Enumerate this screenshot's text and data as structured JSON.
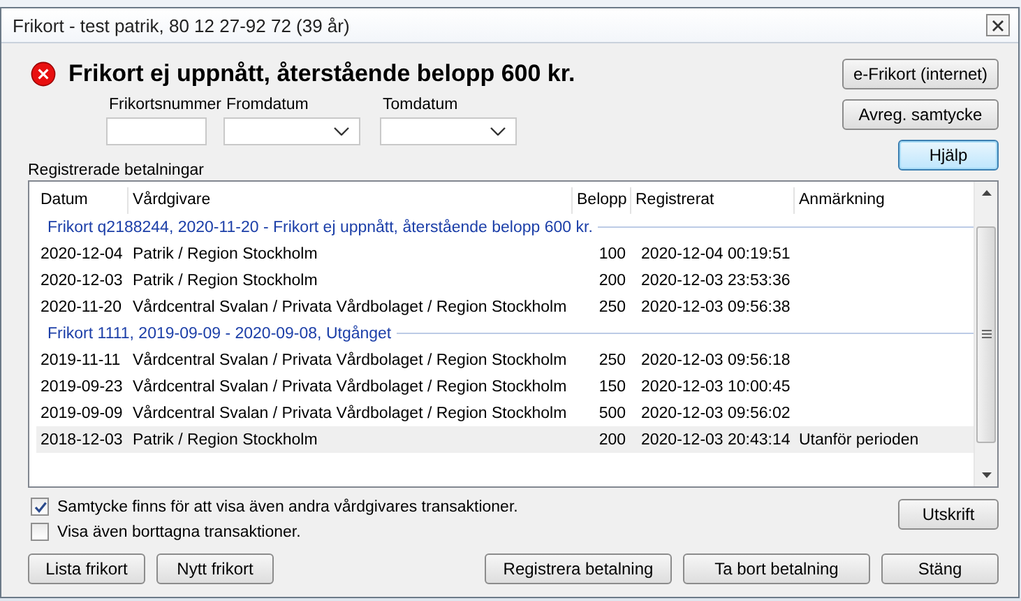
{
  "window": {
    "title": "Frikort - test patrik, 80 12 27-92 72 (39 år)"
  },
  "status": {
    "kind": "error",
    "message": "Frikort ej uppnått, återstående belopp 600 kr."
  },
  "fields": [
    {
      "label": "Frikortsnummer",
      "kind": "text"
    },
    {
      "label": "Fromdatum",
      "kind": "dropdown"
    },
    {
      "label": "Tomdatum",
      "kind": "dropdown"
    }
  ],
  "side_buttons": [
    {
      "label": "e-Frikort (internet)",
      "focused": false
    },
    {
      "label": "Avreg. samtycke",
      "focused": false
    },
    {
      "label": "Hjälp",
      "focused": true
    }
  ],
  "table": {
    "title": "Registrerade betalningar",
    "columns": [
      "Datum",
      "Vårdgivare",
      "Belopp",
      "Registrerat",
      "Anmärkning"
    ],
    "rows": [
      {
        "kind": "group",
        "text": "Frikort q2188244, 2020-11-20 - Frikort ej uppnått, återstående belopp 600 kr."
      },
      {
        "kind": "payment",
        "cells": [
          "2020-12-04",
          "Patrik / Region Stockholm",
          "100",
          "2020-12-04 00:19:51",
          ""
        ],
        "selected": false
      },
      {
        "kind": "payment",
        "cells": [
          "2020-12-03",
          "Patrik / Region Stockholm",
          "200",
          "2020-12-03 23:53:36",
          ""
        ],
        "selected": false
      },
      {
        "kind": "payment",
        "cells": [
          "2020-11-20",
          "Vårdcentral Svalan / Privata Vårdbolaget / Region Stockholm",
          "250",
          "2020-12-03 09:56:38",
          ""
        ],
        "selected": false
      },
      {
        "kind": "group",
        "text": "Frikort 1111, 2019-09-09 - 2020-09-08, Utgånget"
      },
      {
        "kind": "payment",
        "cells": [
          "2019-11-11",
          "Vårdcentral Svalan / Privata Vårdbolaget / Region Stockholm",
          "250",
          "2020-12-03 09:56:18",
          ""
        ],
        "selected": false
      },
      {
        "kind": "payment",
        "cells": [
          "2019-09-23",
          "Vårdcentral Svalan / Privata Vårdbolaget / Region Stockholm",
          "150",
          "2020-12-03 10:00:45",
          ""
        ],
        "selected": false
      },
      {
        "kind": "payment",
        "cells": [
          "2019-09-09",
          "Vårdcentral Svalan / Privata Vårdbolaget / Region Stockholm",
          "500",
          "2020-12-03 09:56:02",
          ""
        ],
        "selected": false
      },
      {
        "kind": "payment",
        "cells": [
          "2018-12-03",
          "Patrik / Region Stockholm",
          "200",
          "2020-12-03 20:43:14",
          "Utanför perioden"
        ],
        "selected": true
      }
    ]
  },
  "checkboxes": [
    {
      "label": "Samtycke finns för att visa även andra vårdgivares transaktioner.",
      "checked": true
    },
    {
      "label": "Visa även borttagna transaktioner.",
      "checked": false
    }
  ],
  "print_button": "Utskrift",
  "bottom_left_buttons": [
    "Lista frikort",
    "Nytt frikort"
  ],
  "bottom_right_buttons": [
    "Registrera betalning",
    "Ta bort betalning",
    "Stäng"
  ]
}
